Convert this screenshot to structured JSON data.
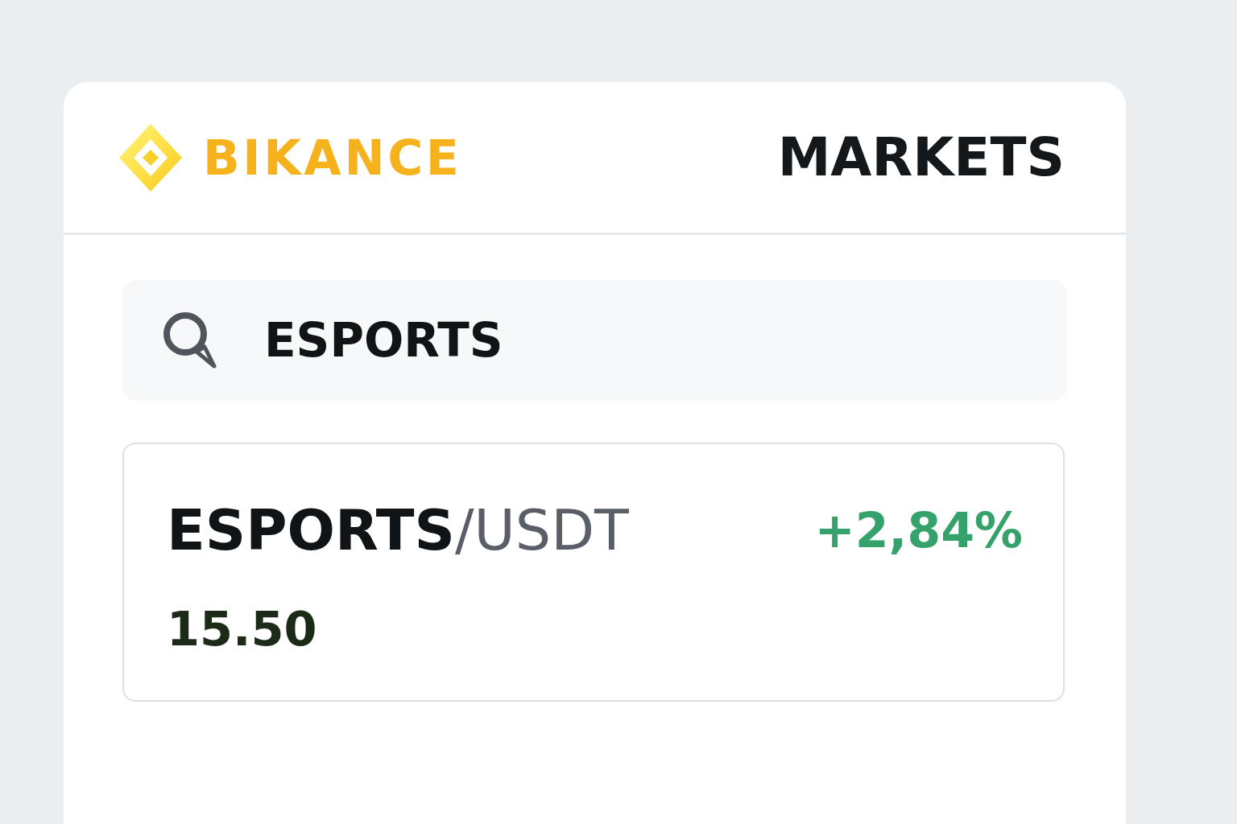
{
  "header": {
    "logo_text": "BIKANCE",
    "title": "MARKETS"
  },
  "search": {
    "value": "ESPORTS"
  },
  "markets": [
    {
      "base": "ESPORTS",
      "quote": "/USDT",
      "change": "+2,84%",
      "positive": true,
      "price": "15.50"
    }
  ]
}
